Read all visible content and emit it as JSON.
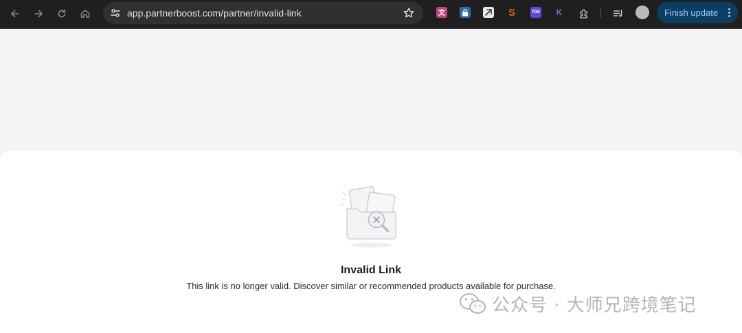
{
  "browser": {
    "url": "app.partnerboost.com/partner/invalid-link",
    "update_button_label": "Finish update",
    "extensions": [
      {
        "name": "translate-extension-icon",
        "label": "",
        "color": "#c2447d"
      },
      {
        "name": "lock-extension-icon",
        "label": "",
        "color": "#2b6cb0"
      },
      {
        "name": "script-extension-icon",
        "label": "",
        "color": "#5a5a5a"
      },
      {
        "name": "s-extension-icon",
        "label": "S",
        "color": "#e25a1c"
      },
      {
        "name": "tdk-extension-icon",
        "label": "TDK",
        "color": "#5b4bd6"
      },
      {
        "name": "k-extension-icon",
        "label": "K",
        "color": "#6b3fa0"
      }
    ]
  },
  "page": {
    "title": "Invalid Link",
    "description": "This link is no longer valid. Discover similar or recommended products available for purchase."
  },
  "watermark": {
    "text": "公众号 · 大师兄跨境笔记"
  }
}
